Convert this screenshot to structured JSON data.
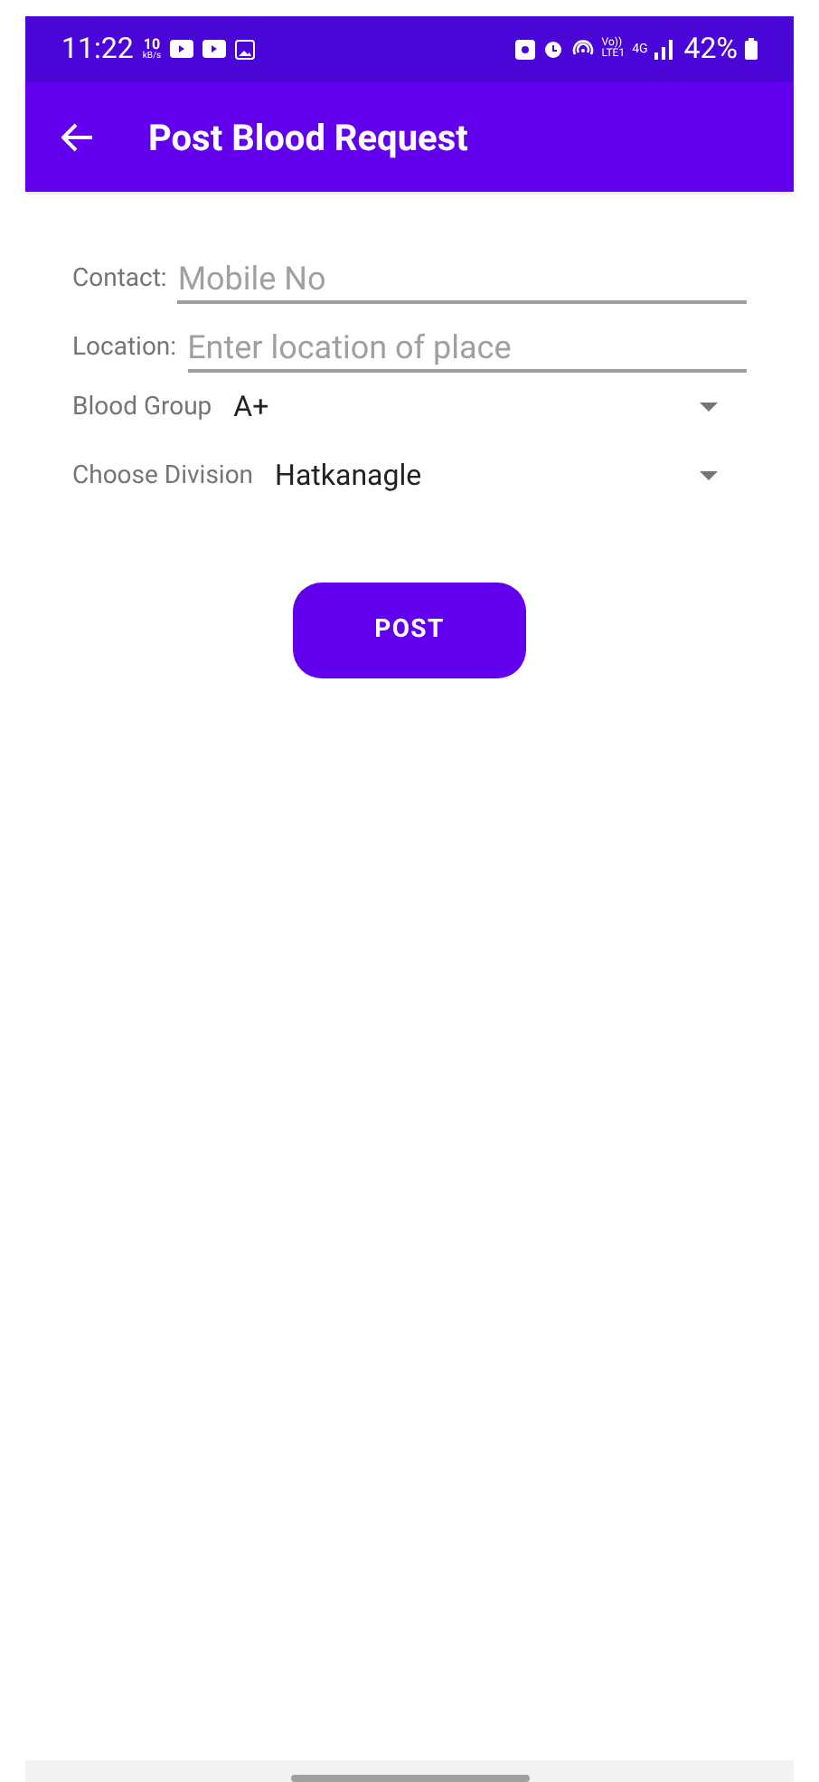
{
  "status_bar": {
    "time": "11:22",
    "speed_value": "10",
    "speed_unit": "kB/s",
    "volte": "Vo))",
    "lte": "LTE1",
    "network": "4G",
    "battery": "42%"
  },
  "app_bar": {
    "title": "Post Blood Request"
  },
  "fields": [
    {
      "kind": "text",
      "label": "Contact:",
      "placeholder": "Mobile No"
    },
    {
      "kind": "text",
      "label": "Location:",
      "placeholder": "Enter location of place"
    },
    {
      "kind": "dropdown",
      "label": "Blood Group",
      "value": "A+"
    },
    {
      "kind": "dropdown",
      "label": "Choose Division",
      "value": "Hatkanagle"
    }
  ],
  "post_button": {
    "label": "POST"
  }
}
